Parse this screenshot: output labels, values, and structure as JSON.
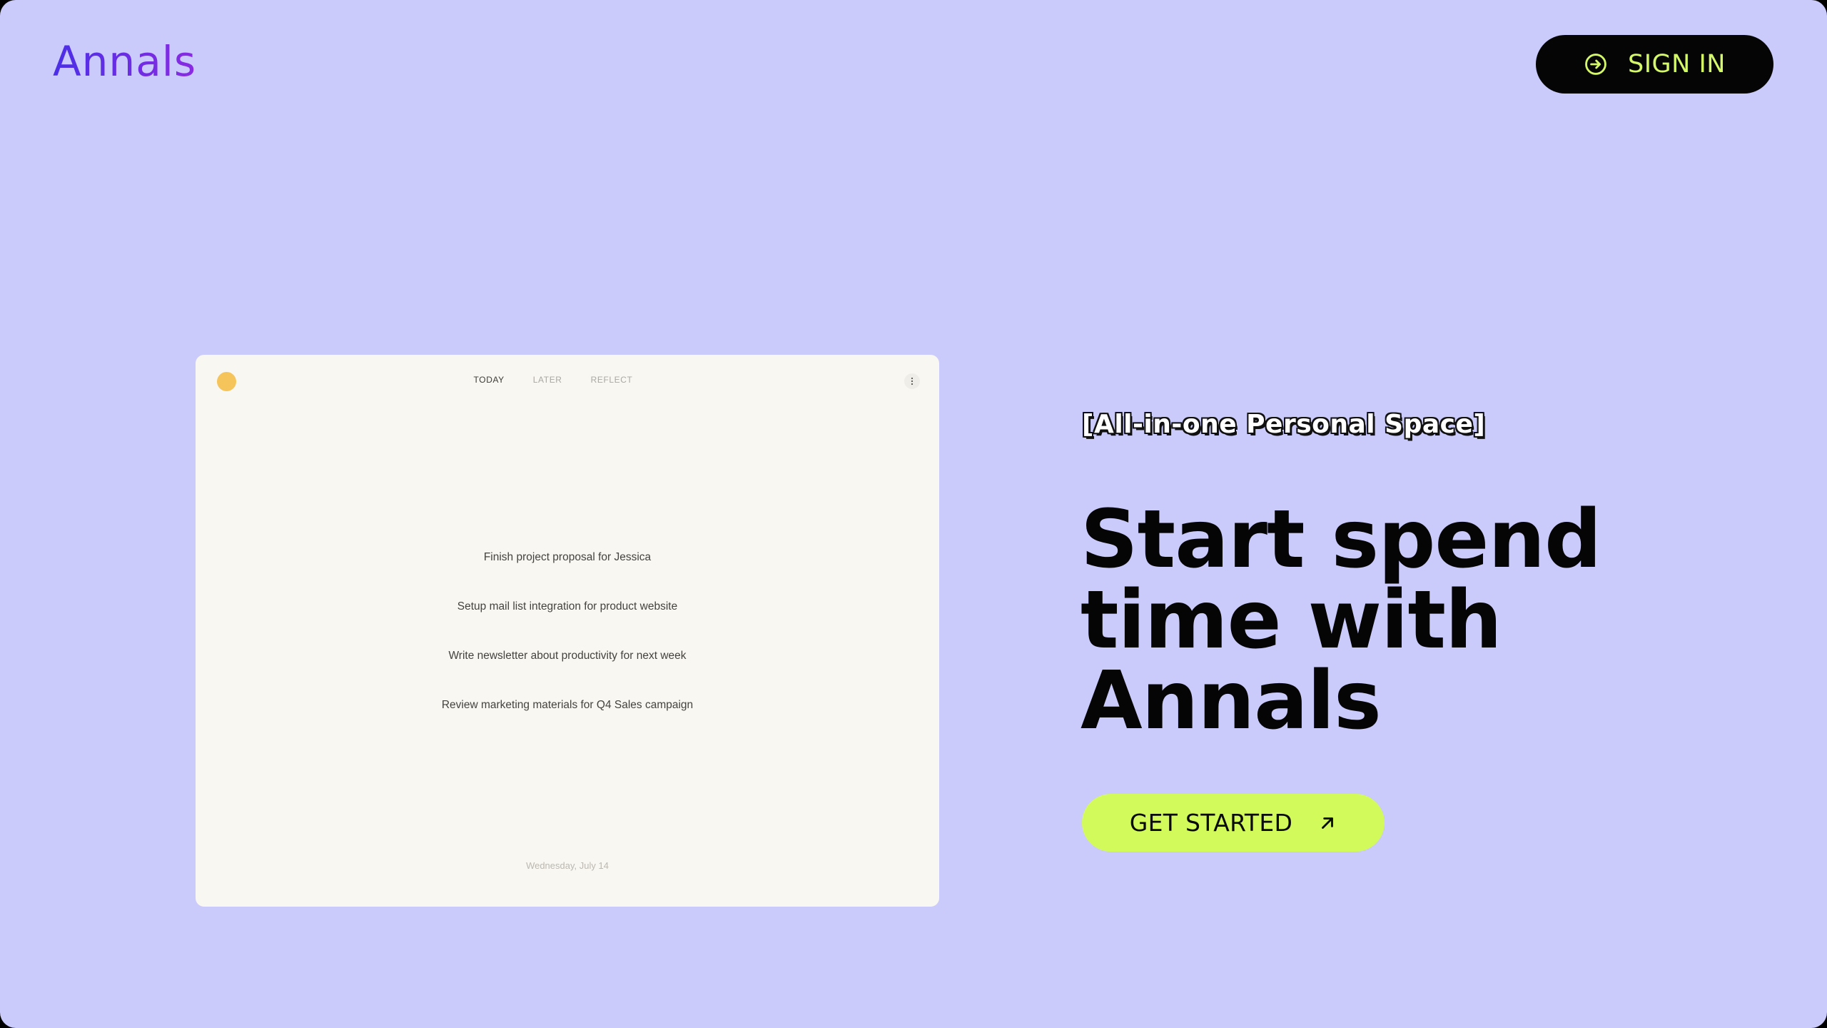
{
  "brand": {
    "name": "Annals"
  },
  "header": {
    "signin_label": "SIGN IN",
    "signin_icon": "sign-in-icon"
  },
  "app_preview": {
    "tabs": [
      {
        "label": "TODAY",
        "active": true
      },
      {
        "label": "LATER",
        "active": false
      },
      {
        "label": "REFLECT",
        "active": false
      }
    ],
    "menu_icon": "more-vertical-icon",
    "tasks": [
      "Finish project proposal for Jessica",
      "Setup mail list integration for product website",
      "Write newsletter about productivity for next week",
      "Review marketing materials for Q4 Sales campaign"
    ],
    "date": "Wednesday, July 14"
  },
  "hero": {
    "tagline": "[All-in-one Personal Space]",
    "headline_lines": [
      "Start spend",
      "time with",
      "Annals"
    ],
    "cta_label": "GET STARTED",
    "cta_icon": "arrow-up-right-icon"
  },
  "colors": {
    "background": "#cacafb",
    "accent_lime": "#d2fa5b",
    "logo_gradient_start": "#4a2fe6",
    "logo_gradient_end": "#8a2be2",
    "dot": "#f5c45a"
  }
}
